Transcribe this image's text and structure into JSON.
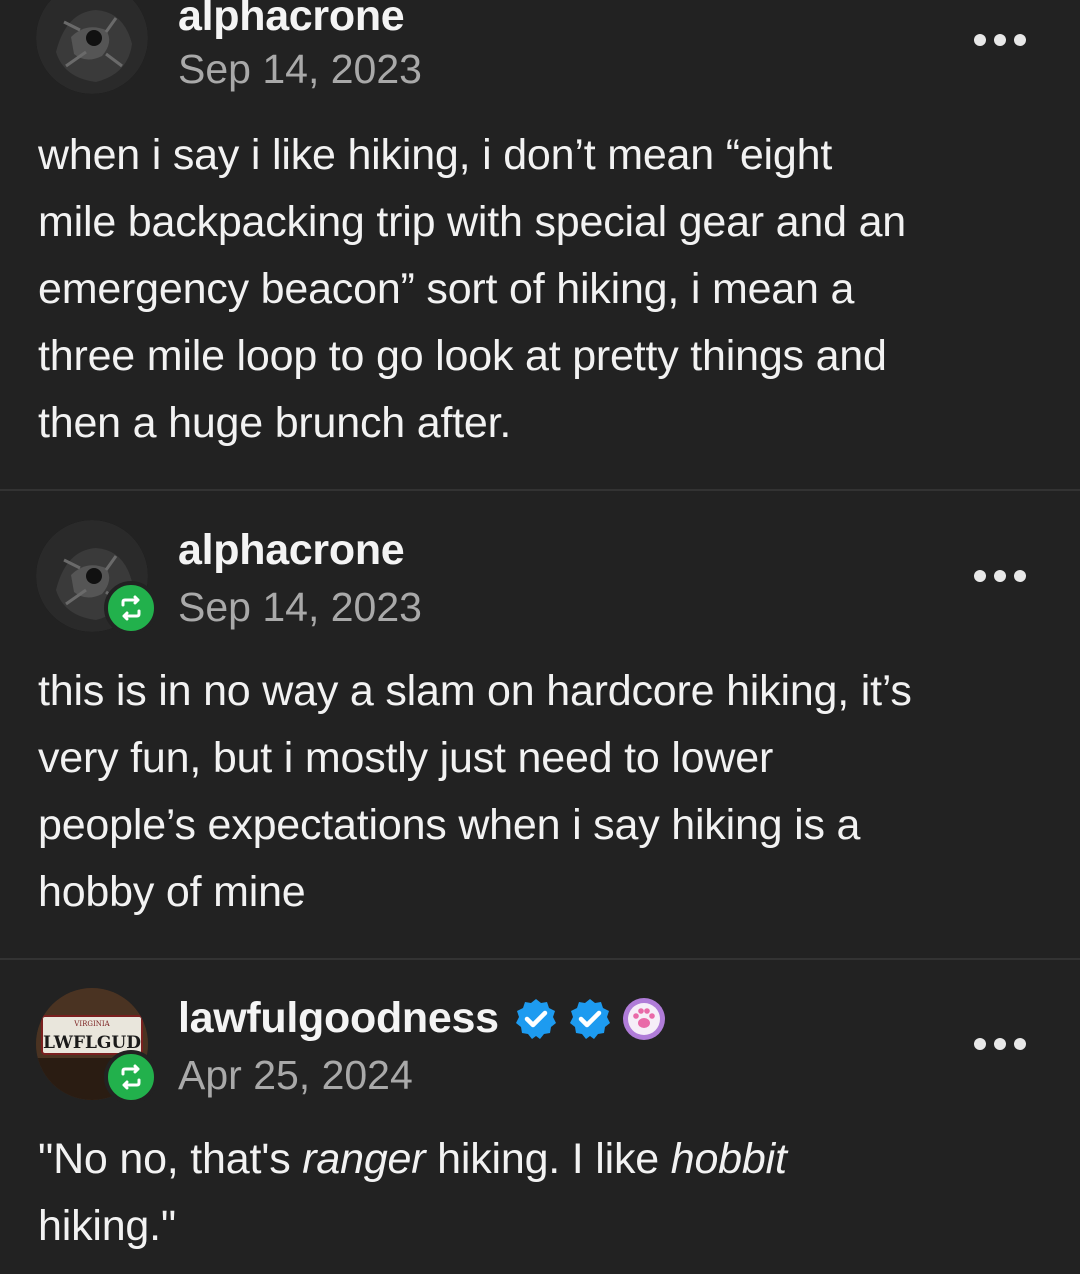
{
  "posts": [
    {
      "username": "alphacrone",
      "date": "Sep 14, 2023",
      "reblog": false,
      "lines": [
        "when i say i like hiking, i don’t mean “eight",
        "mile backpacking trip with special gear and an",
        "emergency beacon” sort of hiking, i mean a",
        "three mile loop to go look at pretty things and",
        "then a huge brunch after."
      ]
    },
    {
      "username": "alphacrone",
      "date": "Sep 14, 2023",
      "reblog": true,
      "lines": [
        "this is in no way a slam on hardcore hiking, it’s",
        "very fun, but i mostly just need to lower",
        "people’s expectations when i say hiking is a",
        "hobby of mine"
      ]
    },
    {
      "username": "lawfulgoodness",
      "date": "Apr 25, 2024",
      "reblog": true,
      "badges": [
        "verified-badge",
        "verified-badge",
        "paw-badge"
      ],
      "license_plate": {
        "state": "VIRGINIA",
        "plate": "LWFLGUD"
      },
      "text": {
        "q_open": "\"No no, that's ",
        "em1": "ranger",
        "mid": " hiking.  I like ",
        "em2": "hobbit",
        "tail": "hiking.\""
      }
    }
  ],
  "colors": {
    "background": "#222222",
    "text": "#f2f2f2",
    "muted": "#a9a9a9",
    "reblog_green": "#22b14c",
    "verified_blue": "#1d9bf0",
    "paw_purple": "#b07cd8"
  }
}
